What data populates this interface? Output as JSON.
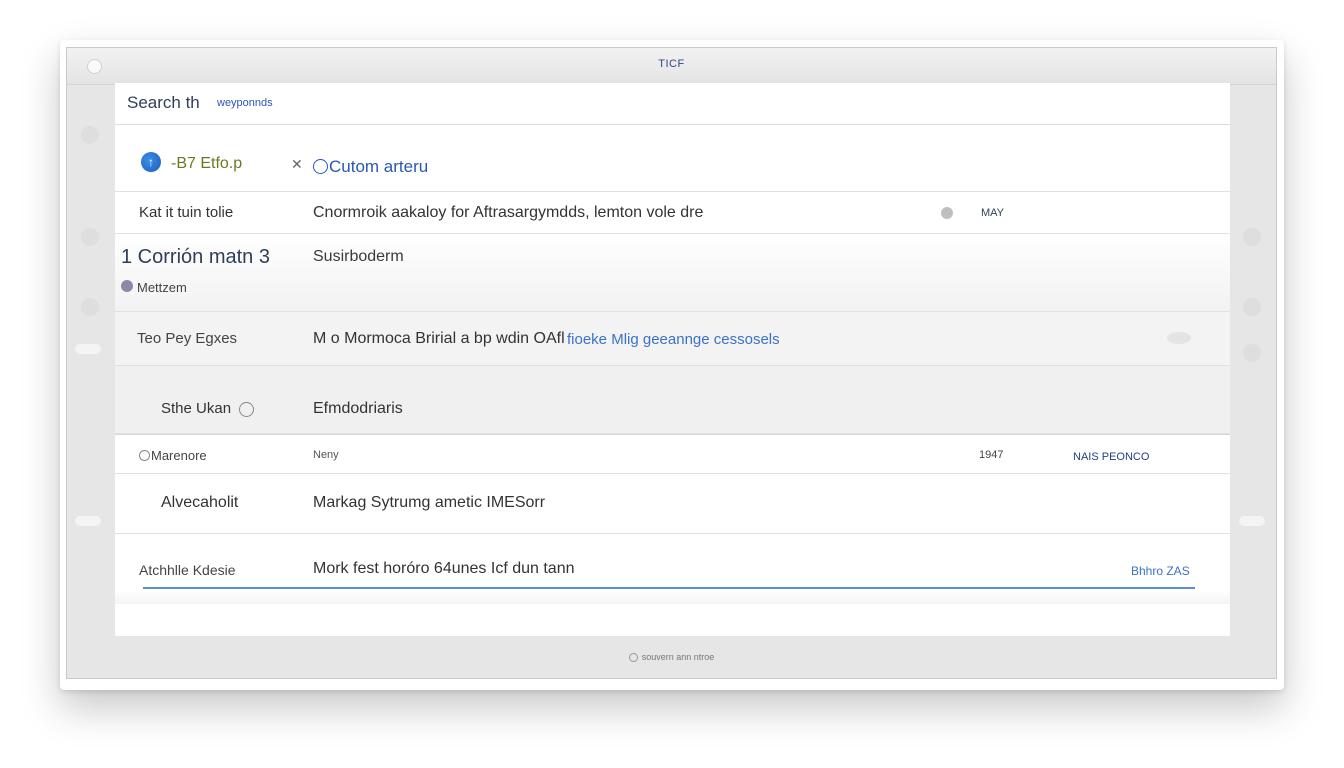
{
  "window": {
    "title": "TICF"
  },
  "search": {
    "label": "Search th",
    "value": "weyponnds"
  },
  "header": {
    "app_name": "-B7 Etfo.p",
    "custom_menu": "Cutom arteru"
  },
  "rows": [
    {
      "col1": "Kat it tuin tolie",
      "col2": "Cnormroik aakaloy for Aftrasargymdds, lemton vole  dre",
      "col3": "MAY"
    },
    {
      "col1": "1 Corrión matn 3",
      "col1_sub": "Mettzem",
      "col2": "Susirboderm"
    },
    {
      "col1": "Teo  Pey Egxes",
      "col2": "M o Mormoca Bririal a bp wdin OAfl",
      "col2_link": "fioeke Mlig geeannge cessosels"
    },
    {
      "col1": "Sthe Ukan",
      "col2": "Efmdodriaris"
    },
    {
      "col1": "Marenore",
      "col2": "Neny",
      "col3": "1947",
      "col4": "NAIS PEONCO"
    },
    {
      "col1": "Alvecaholit",
      "col2": "Markag Sytrumg ametic IMESorr"
    },
    {
      "col1": "Atchhlle Kdesie",
      "col2": "Mork fest horóro 64unes Icf dun tann",
      "col3": "Bhhro  ZAS"
    }
  ],
  "footer": {
    "status": "souvern ann ntroe"
  },
  "colors": {
    "accent": "#2a56b6",
    "title_text": "#2b4a86",
    "underline": "#5a8fd4"
  }
}
